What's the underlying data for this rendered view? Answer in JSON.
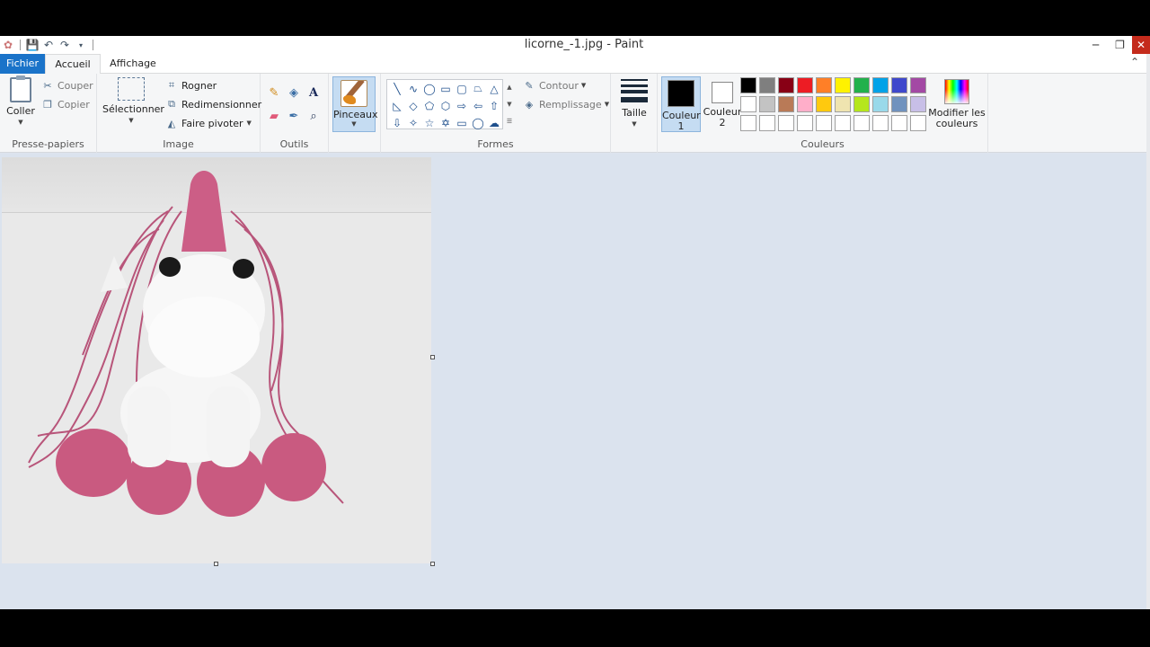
{
  "window": {
    "title": "licorne_-1.jpg - Paint",
    "controls": {
      "minimize": "─",
      "restore": "❐",
      "close": "✕"
    }
  },
  "quick_access": {
    "save_icon": "save-icon",
    "undo_icon": "undo-icon",
    "redo_icon": "redo-icon"
  },
  "tabs": {
    "file": "Fichier",
    "home": "Accueil",
    "view": "Affichage"
  },
  "clipboard": {
    "label": "Presse-papiers",
    "paste": "Coller",
    "cut": "Couper",
    "copy": "Copier"
  },
  "image": {
    "label": "Image",
    "select": "Sélectionner",
    "crop": "Rogner",
    "resize": "Redimensionner",
    "rotate": "Faire pivoter"
  },
  "tools": {
    "label": "Outils"
  },
  "brushes": {
    "label": "Pinceaux"
  },
  "shapes": {
    "label": "Formes",
    "outline": "Contour",
    "fill": "Remplissage"
  },
  "size": {
    "label": "Taille"
  },
  "colors": {
    "label": "Couleurs",
    "color1": "Couleur 1",
    "color2": "Couleur 2",
    "edit": "Modifier les couleurs",
    "color1_value": "#000000",
    "color2_value": "#ffffff",
    "palette_row1": [
      "#000000",
      "#7f7f7f",
      "#880015",
      "#ed1c24",
      "#ff7f27",
      "#fff200",
      "#22b14c",
      "#00a2e8",
      "#3f48cc",
      "#a349a4"
    ],
    "palette_row2": [
      "#ffffff",
      "#c3c3c3",
      "#b97a57",
      "#ffaec9",
      "#ffc90e",
      "#efe4b0",
      "#b5e61d",
      "#99d9ea",
      "#7092be",
      "#c8bfe7"
    ],
    "palette_row3": [
      "#ffffff",
      "#ffffff",
      "#ffffff",
      "#ffffff",
      "#ffffff",
      "#ffffff",
      "#ffffff",
      "#ffffff",
      "#ffffff",
      "#ffffff"
    ]
  }
}
